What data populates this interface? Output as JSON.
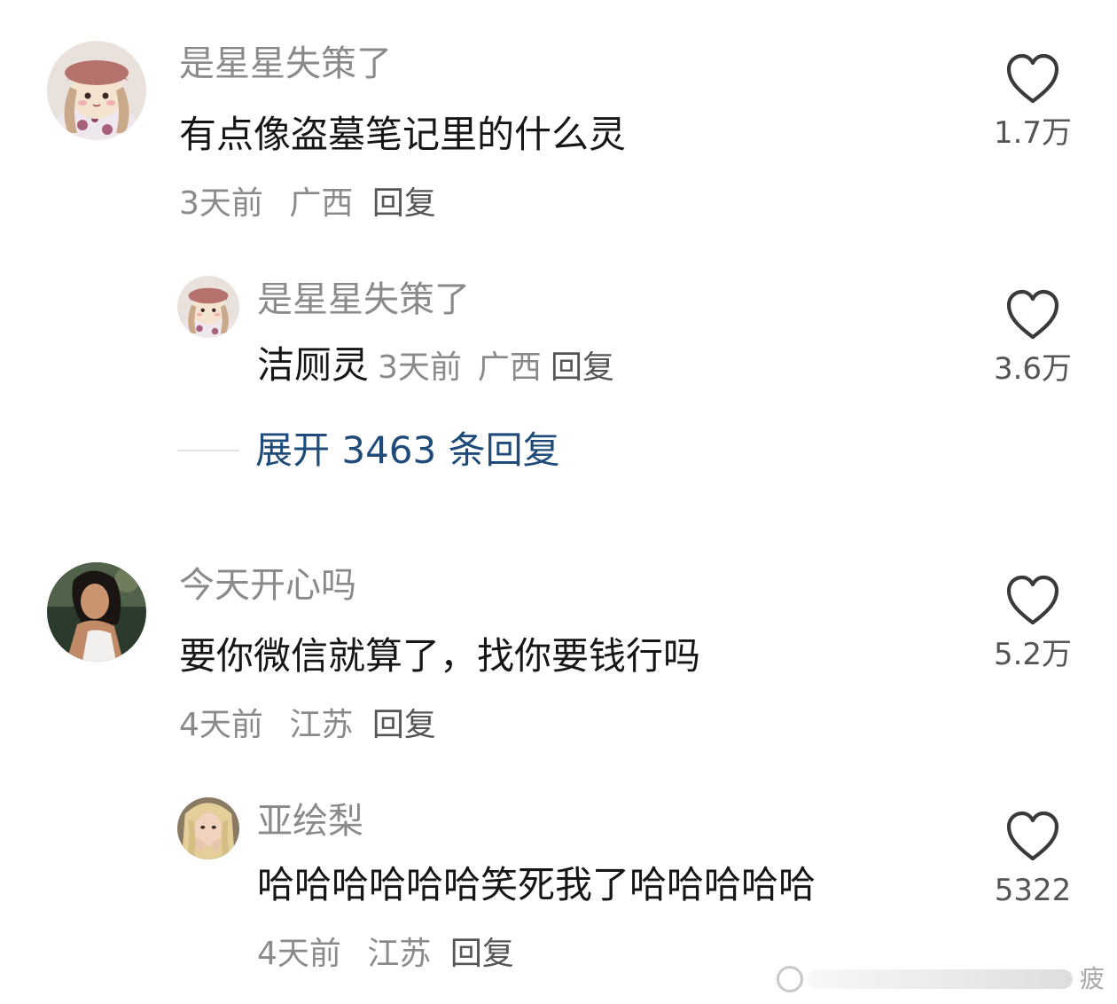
{
  "comments": [
    {
      "username": "是星星失策了",
      "text": "有点像盗墓笔记里的什么灵",
      "time": "3天前",
      "location": "广西",
      "reply": "回复",
      "likes": "1.7万",
      "avatar": "doll-avatar"
    },
    {
      "username": "是星星失策了",
      "text": "洁厕灵",
      "time": "3天前",
      "location": "广西",
      "reply": "回复",
      "likes": "3.6万",
      "avatar": "doll-avatar"
    },
    {
      "username": "今天开心吗",
      "text": "要你微信就算了，找你要钱行吗",
      "time": "4天前",
      "location": "江苏",
      "reply": "回复",
      "likes": "5.2万",
      "avatar": "woman-photo-avatar"
    },
    {
      "username": "亚绘梨",
      "text": "哈哈哈哈哈哈笑死我了哈哈哈哈哈",
      "time": "4天前",
      "location": "江苏",
      "reply": "回复",
      "likes": "5322",
      "avatar": "blonde-photo-avatar"
    }
  ],
  "expand_replies": "展开 3463 条回复",
  "icons": {
    "like": "heart-outline-icon"
  },
  "colors": {
    "link": "#1f4b7a",
    "secondary_text": "#8a8a8a",
    "primary_text": "#161616"
  },
  "watermark": {
    "text": "疲"
  }
}
